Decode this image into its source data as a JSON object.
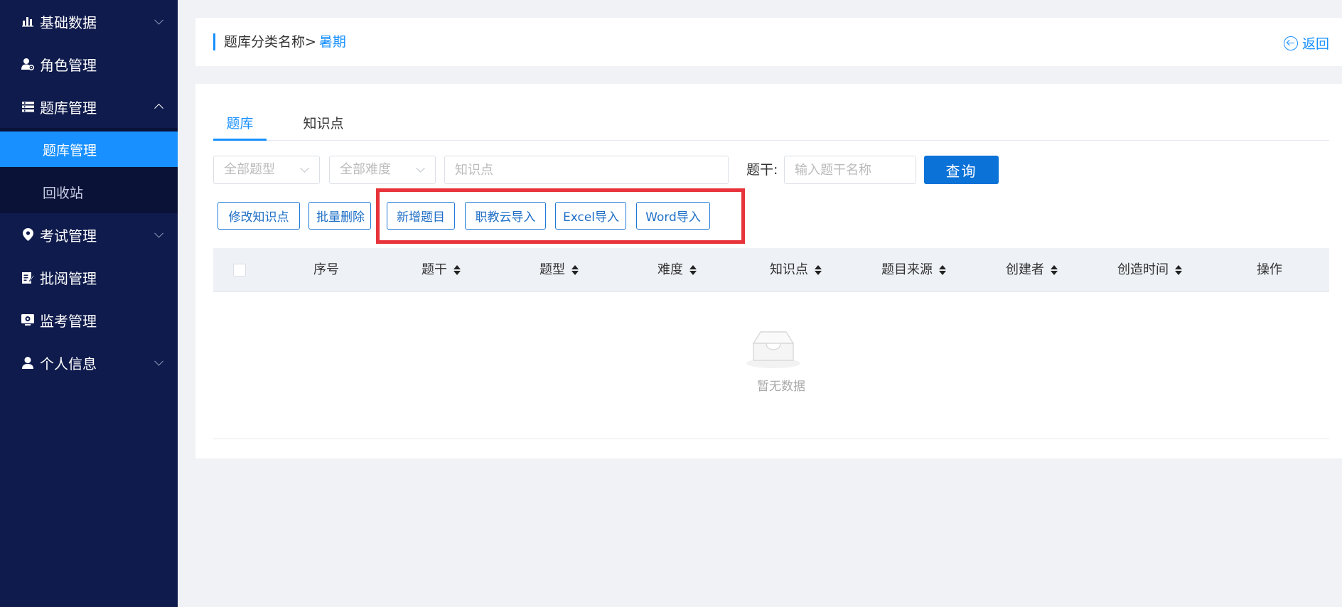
{
  "sidebar": {
    "items": [
      {
        "label": "基础数据",
        "icon": "bar-chart-icon"
      },
      {
        "label": "角色管理",
        "icon": "user-gear-icon"
      },
      {
        "label": "题库管理",
        "icon": "list-icon"
      },
      {
        "label": "考试管理",
        "icon": "map-pin-icon"
      },
      {
        "label": "批阅管理",
        "icon": "edit-doc-icon"
      },
      {
        "label": "监考管理",
        "icon": "monitor-icon"
      },
      {
        "label": "个人信息",
        "icon": "person-icon"
      }
    ],
    "submenu": [
      {
        "label": "题库管理"
      },
      {
        "label": "回收站"
      }
    ]
  },
  "header": {
    "breadcrumb_prefix": "题库分类名称>",
    "breadcrumb_current": "暑期",
    "back_label": "返回"
  },
  "tabs": [
    {
      "label": "题库"
    },
    {
      "label": "知识点"
    }
  ],
  "filters": {
    "type_placeholder": "全部题型",
    "difficulty_placeholder": "全部难度",
    "knowledge_placeholder": "知识点",
    "stem_label": "题干:",
    "stem_placeholder": "输入题干名称",
    "query_label": "查询"
  },
  "actions": [
    {
      "label": "修改知识点"
    },
    {
      "label": "批量删除"
    },
    {
      "label": "新增题目"
    },
    {
      "label": "职教云导入"
    },
    {
      "label": "Excel导入"
    },
    {
      "label": "Word导入"
    }
  ],
  "table": {
    "columns": [
      {
        "label": "序号",
        "sortable": false
      },
      {
        "label": "题干",
        "sortable": true
      },
      {
        "label": "题型",
        "sortable": true
      },
      {
        "label": "难度",
        "sortable": true
      },
      {
        "label": "知识点",
        "sortable": true
      },
      {
        "label": "题目来源",
        "sortable": true
      },
      {
        "label": "创建者",
        "sortable": true
      },
      {
        "label": "创造时间",
        "sortable": true
      },
      {
        "label": "操作",
        "sortable": false
      }
    ],
    "empty_text": "暂无数据"
  },
  "colors": {
    "sidebar_bg": "#0f1b4c",
    "accent": "#1890ff",
    "highlight": "#e8333a"
  }
}
